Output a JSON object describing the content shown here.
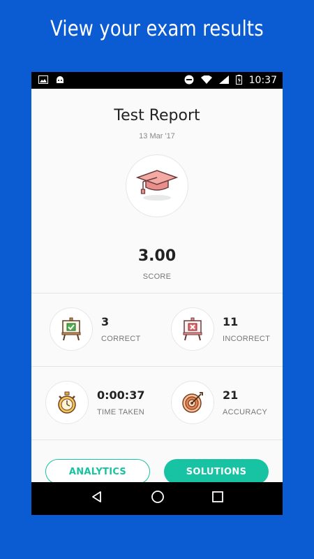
{
  "promo": {
    "headline": "View your exam results"
  },
  "statusbar": {
    "time": "10:37"
  },
  "report": {
    "title": "Test Report",
    "date": "13 Mar '17",
    "score_value": "3.00",
    "score_label": "SCORE"
  },
  "stats": [
    {
      "value": "3",
      "label": "CORRECT",
      "icon": "correct-easel-icon"
    },
    {
      "value": "11",
      "label": "INCORRECT",
      "icon": "incorrect-easel-icon"
    },
    {
      "value": "0:00:37",
      "label": "TIME TAKEN",
      "icon": "stopwatch-icon"
    },
    {
      "value": "21",
      "label": "ACCURACY",
      "icon": "target-icon"
    }
  ],
  "buttons": {
    "analytics": "ANALYTICS",
    "solutions": "SOLUTIONS"
  },
  "colors": {
    "background": "#0b5bd2",
    "accent": "#17c3a2"
  }
}
